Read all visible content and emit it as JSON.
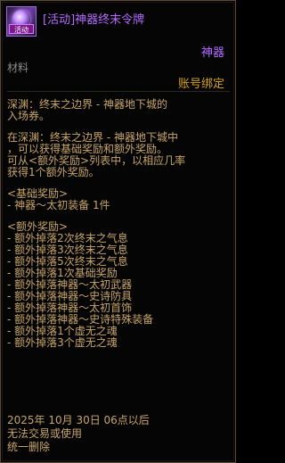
{
  "item": {
    "title": "[活动]神器终末令牌",
    "icon_badge": "活动",
    "type": "神器",
    "category": "材料",
    "bind": "账号绑定"
  },
  "description": {
    "intro": [
      "深渊：终末之边界 - 神器地下城的",
      "入场券。"
    ],
    "details": [
      "在深渊：终末之边界 - 神器地下城中",
      "，可以获得基础奖励和额外奖励。",
      "可从<额外奖励>列表中，以相应几率",
      "获得1个额外奖励。"
    ],
    "base_reward_header": "<基础奖励>",
    "base_rewards": [
      "- 神器～太初装备 1件"
    ],
    "extra_reward_header": "<额外奖励>",
    "extra_rewards": [
      "- 额外掉落2次终末之气息",
      "- 额外掉落3次终末之气息",
      "- 额外掉落5次终末之气息",
      "- 额外掉落1次基础奖励",
      "- 额外掉落神器～太初武器",
      "- 额外掉落神器～史诗防具",
      "- 额外掉落神器～太初首饰",
      "- 额外掉落神器～史诗特殊装备",
      "- 额外掉落1个虚无之魂",
      "- 额外掉落3个虚无之魂"
    ]
  },
  "footer": {
    "expire": "2025年 10月 30日 06点以后",
    "restriction_1": "无法交易或使用",
    "restriction_2": "统一删除"
  }
}
